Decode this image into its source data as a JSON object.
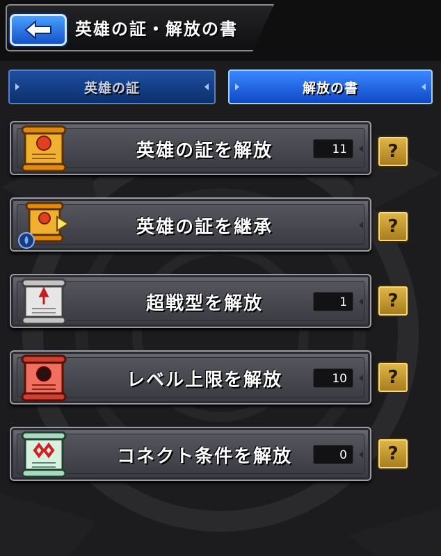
{
  "header": {
    "title": "英雄の証・解放の書",
    "back_icon": "back-arrow-icon"
  },
  "tabs": [
    {
      "label": "英雄の証",
      "active": false
    },
    {
      "label": "解放の書",
      "active": true
    }
  ],
  "menu": [
    {
      "label": "英雄の証を解放",
      "count": "11",
      "icon": "hero-proof-scroll-icon",
      "help": "?"
    },
    {
      "label": "英雄の証を継承",
      "count": null,
      "icon": "inherit-scroll-icon",
      "help": "?"
    },
    {
      "label": "超戦型を解放",
      "count": "1",
      "icon": "super-battle-scroll-icon",
      "help": "?"
    },
    {
      "label": "レベル上限を解放",
      "count": "10",
      "icon": "level-cap-scroll-icon",
      "help": "?"
    },
    {
      "label": "コネクト条件を解放",
      "count": "0",
      "icon": "connect-scroll-icon",
      "help": "?"
    }
  ],
  "colors": {
    "tab_active": "#2f7af0",
    "tab_inactive": "#1e4fa0",
    "help_gold": "#d4a53a",
    "row_gray": "#55555d"
  }
}
